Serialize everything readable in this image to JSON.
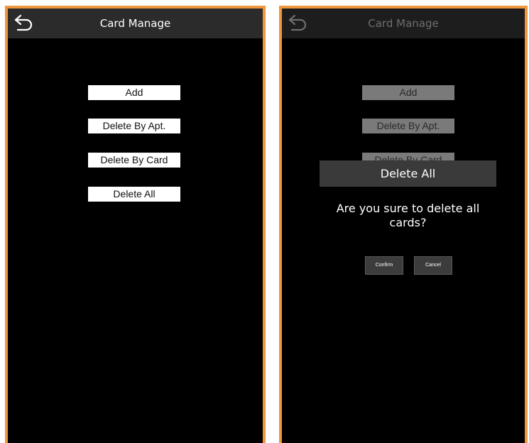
{
  "left_screen": {
    "header": {
      "title": "Card Manage",
      "back_icon": "back-arrow-icon"
    },
    "menu": {
      "add": "Add",
      "delete_by_apt": "Delete By Apt.",
      "delete_by_card": "Delete By Card",
      "delete_all": "Delete All"
    }
  },
  "right_screen": {
    "header": {
      "title": "Card Manage",
      "back_icon": "back-arrow-icon"
    },
    "menu": {
      "add": "Add",
      "delete_by_apt": "Delete By Apt.",
      "delete_by_card": "Delete By Card"
    },
    "dialog": {
      "title": "Delete All",
      "message": "Are you sure to delete all cards?",
      "confirm": "Confirm",
      "cancel": "Cancel"
    }
  },
  "colors": {
    "frame_border": "#f0963c",
    "screen_background": "#000000",
    "header_background": "#2b2b2b",
    "button_background": "#ffffff",
    "dialog_title_background": "#3a3a3a"
  }
}
